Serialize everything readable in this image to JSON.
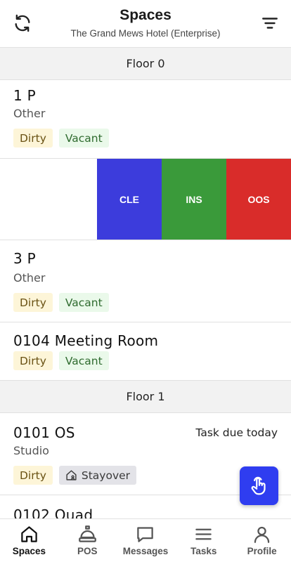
{
  "header": {
    "title": "Spaces",
    "subtitle": "The Grand Mews Hotel (Enterprise)"
  },
  "floors": [
    {
      "label": "Floor 0",
      "spaces": [
        {
          "name": "1 P",
          "type": "Other",
          "tags": [
            "Dirty",
            "Vacant"
          ]
        },
        {
          "swipe_actions": [
            "CLE",
            "INS",
            "OOS"
          ]
        },
        {
          "name": "3 P",
          "type": "Other",
          "tags": [
            "Dirty",
            "Vacant"
          ]
        },
        {
          "name": "0104 Meeting Room",
          "tags": [
            "Dirty",
            "Vacant"
          ]
        }
      ]
    },
    {
      "label": "Floor 1",
      "spaces": [
        {
          "name": "0101 OS",
          "type": "Studio",
          "due": "Task due today",
          "tags": [
            "Dirty",
            "Stayover"
          ]
        },
        {
          "name": "0102 Quad"
        }
      ]
    }
  ],
  "tabs": [
    {
      "label": "Spaces",
      "icon": "home-icon",
      "active": true
    },
    {
      "label": "POS",
      "icon": "service-bell-icon"
    },
    {
      "label": "Messages",
      "icon": "chat-bubble-icon"
    },
    {
      "label": "Tasks",
      "icon": "list-icon"
    },
    {
      "label": "Profile",
      "icon": "user-icon"
    }
  ],
  "colors": {
    "accent": "#2f3df0",
    "cle": "#3c3cdc",
    "ins": "#3a9a3a",
    "oos": "#d92c2a",
    "dirty_bg": "#fdf5d8",
    "vacant_bg": "#eaf9ea"
  }
}
